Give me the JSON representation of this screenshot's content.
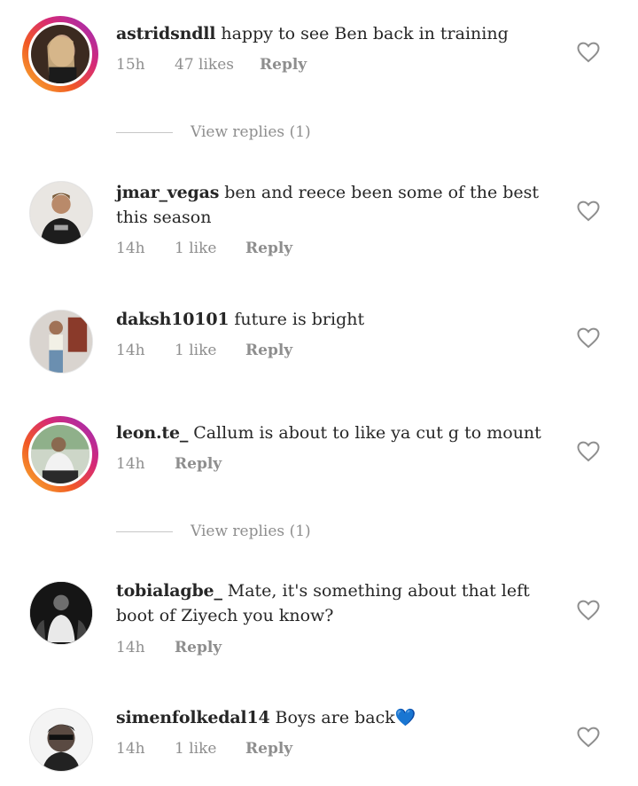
{
  "comments": [
    {
      "username": "astridsndll",
      "text": "happy to see Ben back in training",
      "time": "15h",
      "likes": "47 likes",
      "reply": "Reply",
      "story": true
    },
    {
      "username": "jmar_vegas",
      "text": "ben and reece been some of the best this season",
      "time": "14h",
      "likes": "1 like",
      "reply": "Reply",
      "story": false
    },
    {
      "username": "daksh10101",
      "text": "future is bright",
      "time": "14h",
      "likes": "1 like",
      "reply": "Reply",
      "story": false
    },
    {
      "username": "leon.te_",
      "text": "Callum is about to like ya cut g to mount",
      "time": "14h",
      "likes": "",
      "reply": "Reply",
      "story": true
    },
    {
      "username": "tobialagbe_",
      "text": "Mate, it's something about that left boot of Ziyech you know?",
      "time": "14h",
      "likes": "",
      "reply": "Reply",
      "story": false
    },
    {
      "username": "simenfolkedal14",
      "text": "Boys are back",
      "emoji": "💙",
      "time": "14h",
      "likes": "1 like",
      "reply": "Reply",
      "story": false
    }
  ],
  "view_replies": [
    {
      "label": "View replies (1)"
    },
    {
      "label": "View replies (1)"
    }
  ],
  "colors": {
    "story_ring_start": "#f7b733",
    "story_ring_end": "#962fbf",
    "meta": "#8e8e8e",
    "emoji_heart": "#4fb7ec"
  },
  "icons": {
    "like": "heart-outline-icon"
  }
}
